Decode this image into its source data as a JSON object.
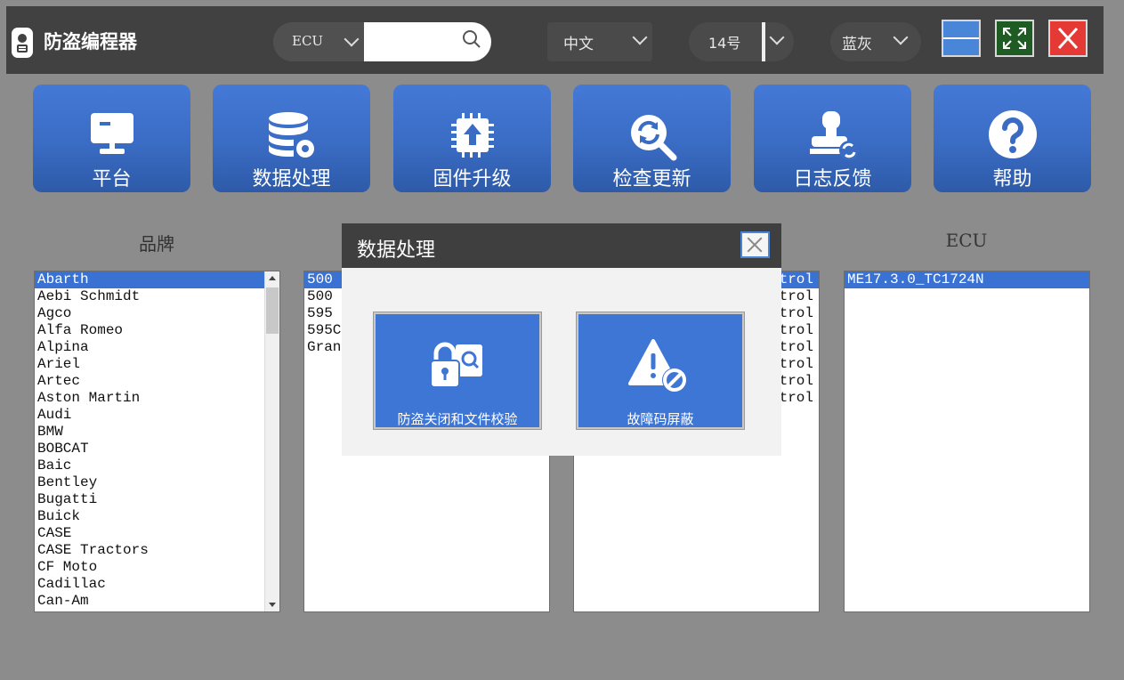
{
  "app": {
    "title": "防盗编程器"
  },
  "search": {
    "category": "ECU",
    "value": ""
  },
  "language": {
    "selected": "中文"
  },
  "font_size": {
    "selected": "14号"
  },
  "theme": {
    "selected": "蓝灰"
  },
  "toolbar": [
    {
      "label": "平台",
      "icon": "monitor-icon"
    },
    {
      "label": "数据处理",
      "icon": "database-gear-icon"
    },
    {
      "label": "固件升级",
      "icon": "chip-upload-icon"
    },
    {
      "label": "检查更新",
      "icon": "search-refresh-icon"
    },
    {
      "label": "日志反馈",
      "icon": "stamp-icon"
    },
    {
      "label": "帮助",
      "icon": "question-icon"
    }
  ],
  "columns": {
    "brand_header": "品牌",
    "ecu_header": "ECU"
  },
  "brands": [
    "Abarth",
    "Aebi Schmidt",
    "Agco",
    "Alfa Romeo",
    "Alpina",
    "Ariel",
    "Artec",
    "Aston Martin",
    "Audi",
    "BMW",
    "BOBCAT",
    "Baic",
    "Bentley",
    "Bugatti",
    "Buick",
    "CASE",
    "CASE Tractors",
    "CF Moto",
    "Cadillac",
    "Can-Am"
  ],
  "models": [
    "500",
    "500 (",
    "595 :",
    "595C",
    "Granc"
  ],
  "types": [
    "trol",
    "trol",
    "trol",
    "trol",
    "trol",
    "trol",
    "trol",
    "trol"
  ],
  "ecus": [
    "ME17.3.0_TC1724N"
  ],
  "dialog": {
    "title": "数据处理",
    "tiles": [
      {
        "label": "防盗关闭和文件校验",
        "icon": "lock-file-search-icon"
      },
      {
        "label": "故障码屏蔽",
        "icon": "warning-block-icon"
      }
    ]
  },
  "colors": {
    "accent": "#3a72d4",
    "titlebar": "#414141",
    "background": "#8c8c8c",
    "close_red": "#e53935"
  }
}
